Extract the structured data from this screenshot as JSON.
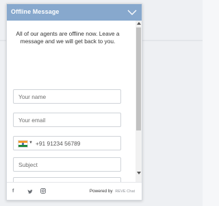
{
  "header": {
    "title": "Offline Message"
  },
  "body": {
    "offline_message": "All of our agents are offline now. Leave a message and we will get back to you."
  },
  "form": {
    "name_placeholder": "Your name",
    "email_placeholder": "Your email",
    "phone": {
      "country_flag": "india-flag-icon",
      "placeholder": "+91 91234 56789"
    },
    "subject_placeholder": "Subject"
  },
  "footer": {
    "powered_by": "Powered by",
    "brand": "REVE Chat",
    "social_icons": [
      "facebook-icon",
      "twitter-icon",
      "instagram-icon"
    ]
  },
  "colors": {
    "header_bg": "#87a8cd",
    "border": "#cfd3d8"
  }
}
